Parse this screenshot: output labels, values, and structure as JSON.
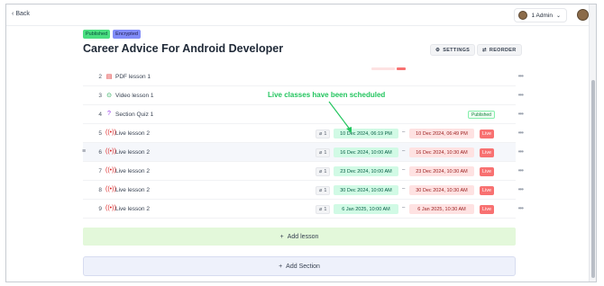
{
  "topbar": {
    "back_label": "Back",
    "admin_label": "1 Admin"
  },
  "course": {
    "badges": {
      "published": "Published",
      "encrypted": "Encrypted"
    },
    "title": "Career Advice For Android Developer",
    "settings_label": "SETTINGS",
    "reorder_label": "REORDER"
  },
  "annotation": "Live classes have been scheduled",
  "lessons": [
    {
      "num": "2",
      "name": "PDF lesson 1",
      "icon": "pdf-icon"
    },
    {
      "num": "3",
      "name": "Video lesson 1",
      "icon": "video-icon"
    },
    {
      "num": "4",
      "name": "Section Quiz 1",
      "icon": "quiz-icon",
      "status": "Published"
    },
    {
      "num": "5",
      "name": "Live lesson 2",
      "icon": "live-icon",
      "attachments": "1",
      "start": "10 Dec 2024, 06:19 PM",
      "end": "10 Dec 2024, 06:49 PM",
      "badge": "Live"
    },
    {
      "num": "6",
      "name": "Live lesson 2",
      "icon": "live-icon",
      "attachments": "1",
      "start": "16 Dec 2024, 10:00 AM",
      "end": "16 Dec 2024, 10:30 AM",
      "badge": "Live"
    },
    {
      "num": "7",
      "name": "Live lesson 2",
      "icon": "live-icon",
      "attachments": "1",
      "start": "23 Dec 2024, 10:00 AM",
      "end": "23 Dec 2024, 10:30 AM",
      "badge": "Live"
    },
    {
      "num": "8",
      "name": "Live lesson 2",
      "icon": "live-icon",
      "attachments": "1",
      "start": "30 Dec 2024, 10:00 AM",
      "end": "30 Dec 2024, 10:30 AM",
      "badge": "Live"
    },
    {
      "num": "9",
      "name": "Live lesson 2",
      "icon": "live-icon",
      "attachments": "1",
      "start": "6 Jan 2025, 10:00 AM",
      "end": "6 Jan 2025, 10:30 AM",
      "badge": "Live"
    }
  ],
  "add_lesson_label": "Add lesson",
  "add_section_label": "Add Section",
  "colors": {
    "start_bg": "#d1fae5",
    "end_bg": "#fee2e2",
    "live_badge": "#f87171",
    "annotation": "#22c55e"
  }
}
